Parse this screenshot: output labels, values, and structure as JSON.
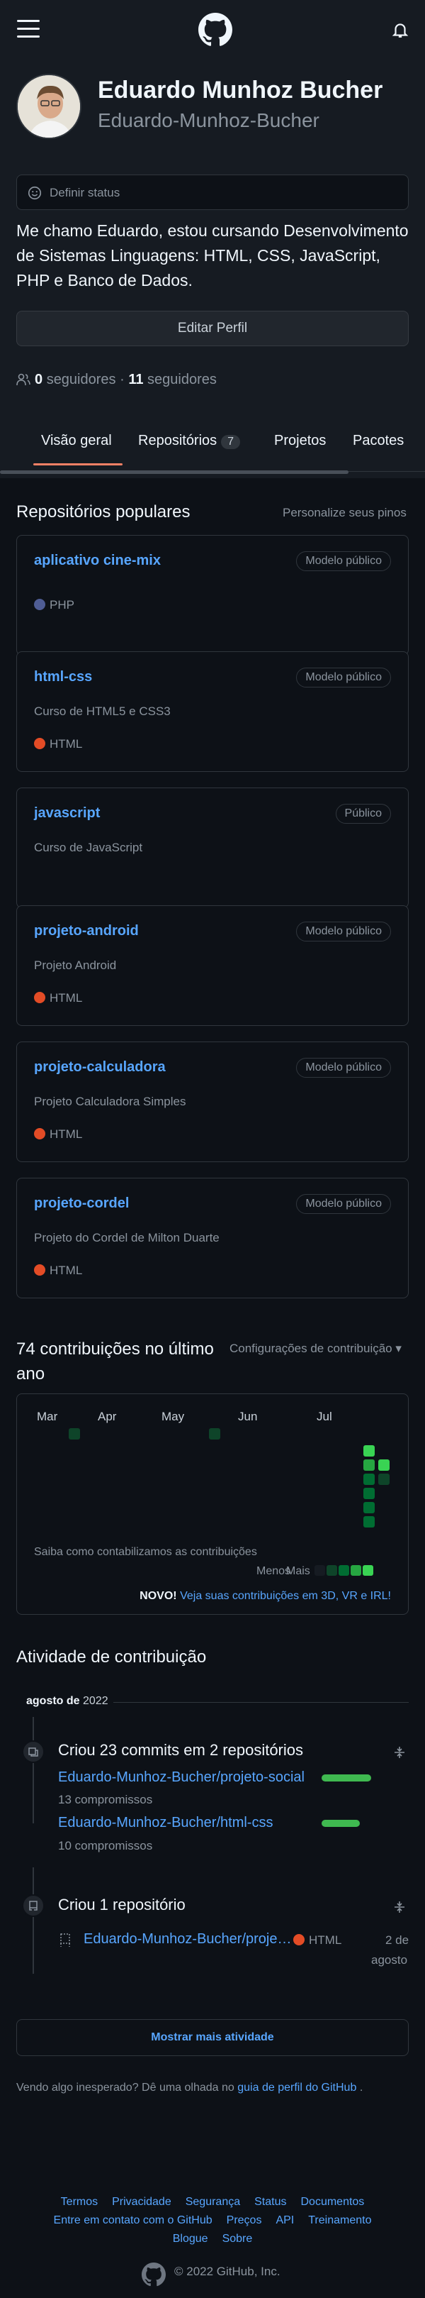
{
  "profile": {
    "name": "Eduardo Munhoz Bucher",
    "login": "Eduardo-Munhoz-Bucher",
    "status_placeholder": "Definir status",
    "bio": "Me chamo Eduardo, estou cursando Desenvolvimento de Sistemas Linguagens: HTML, CSS, JavaScript, PHP e Banco de Dados.",
    "edit_button": "Editar Perfil",
    "followers_count": "0",
    "followers_label": "seguidores",
    "separator": "·",
    "following_count": "11",
    "following_label": "seguidores"
  },
  "tabs": [
    {
      "label": "Visão geral",
      "active": true
    },
    {
      "label": "Repositórios",
      "count": "7"
    },
    {
      "label": "Projetos"
    },
    {
      "label": "Pacotes"
    }
  ],
  "popular": {
    "title": "Repositórios populares",
    "customize": "Personalize seus pinos",
    "repos": [
      {
        "name": "aplicativo cine-mix",
        "badge": "Modelo público",
        "description": "",
        "language": "PHP",
        "lang_color": "#4f5d95"
      },
      {
        "name": "html-css",
        "badge": "Modelo público",
        "description": "Curso de HTML5 e CSS3",
        "language": "HTML",
        "lang_color": "#e34c26"
      },
      {
        "name": "javascript",
        "badge": "Público",
        "description": "Curso de JavaScript",
        "language": "",
        "lang_color": ""
      },
      {
        "name": "projeto-android",
        "badge": "Modelo público",
        "description": "Projeto Android",
        "language": "HTML",
        "lang_color": "#e34c26"
      },
      {
        "name": "projeto-calculadora",
        "badge": "Modelo público",
        "description": "Projeto Calculadora Simples",
        "language": "HTML",
        "lang_color": "#e34c26"
      },
      {
        "name": "projeto-cordel",
        "badge": "Modelo público",
        "description": "Projeto do Cordel de Milton Duarte",
        "language": "HTML",
        "lang_color": "#e34c26"
      }
    ]
  },
  "contributions": {
    "title": "74 contribuições no último ano",
    "settings": "Configurações de contribuição ▾",
    "months": [
      "Mar",
      "Apr",
      "May",
      "Jun",
      "Jul"
    ],
    "learn": "Saiba como contabilizamos as contribuições",
    "less": "Menos",
    "more": "Mais",
    "new_label": "NOVO!",
    "new_link": "Veja suas contribuições em 3D, VR e IRL!"
  },
  "activity": {
    "title": "Atividade de contribuição",
    "month_bold": "agosto de",
    "year": "2022",
    "commits_head": "Criou 23 commits em 2 repositórios",
    "commit_repos": [
      {
        "name": "Eduardo-Munhoz-Bucher/projeto-social",
        "count": "13 compromissos"
      },
      {
        "name": "Eduardo-Munhoz-Bucher/html-css",
        "count": "10 compromissos"
      }
    ],
    "created_head": "Criou 1 repositório",
    "created_repo": "Eduardo-Munhoz-Bucher/proje…",
    "created_lang": "HTML",
    "created_date_1": "2 de",
    "created_date_2": "agosto",
    "more_button": "Mostrar mais atividade",
    "unexpected_prefix": "Vendo algo inesperado? Dê uma olhada no",
    "unexpected_link": "guia de perfil do GitHub",
    "unexpected_suffix": "."
  },
  "footer": {
    "row1": [
      "Termos",
      "Privacidade",
      "Segurança",
      "Status",
      "Documentos"
    ],
    "row2": [
      "Entre em contato com o GitHub",
      "Preços",
      "API",
      "Treinamento"
    ],
    "row3": [
      "Blogue",
      "Sobre"
    ],
    "copyright": "© 2022 GitHub, Inc."
  },
  "colors": {
    "background": "#0d1117",
    "accent_link": "#58a6ff",
    "tab_underline": "#f78166",
    "green": "#3fb950"
  }
}
